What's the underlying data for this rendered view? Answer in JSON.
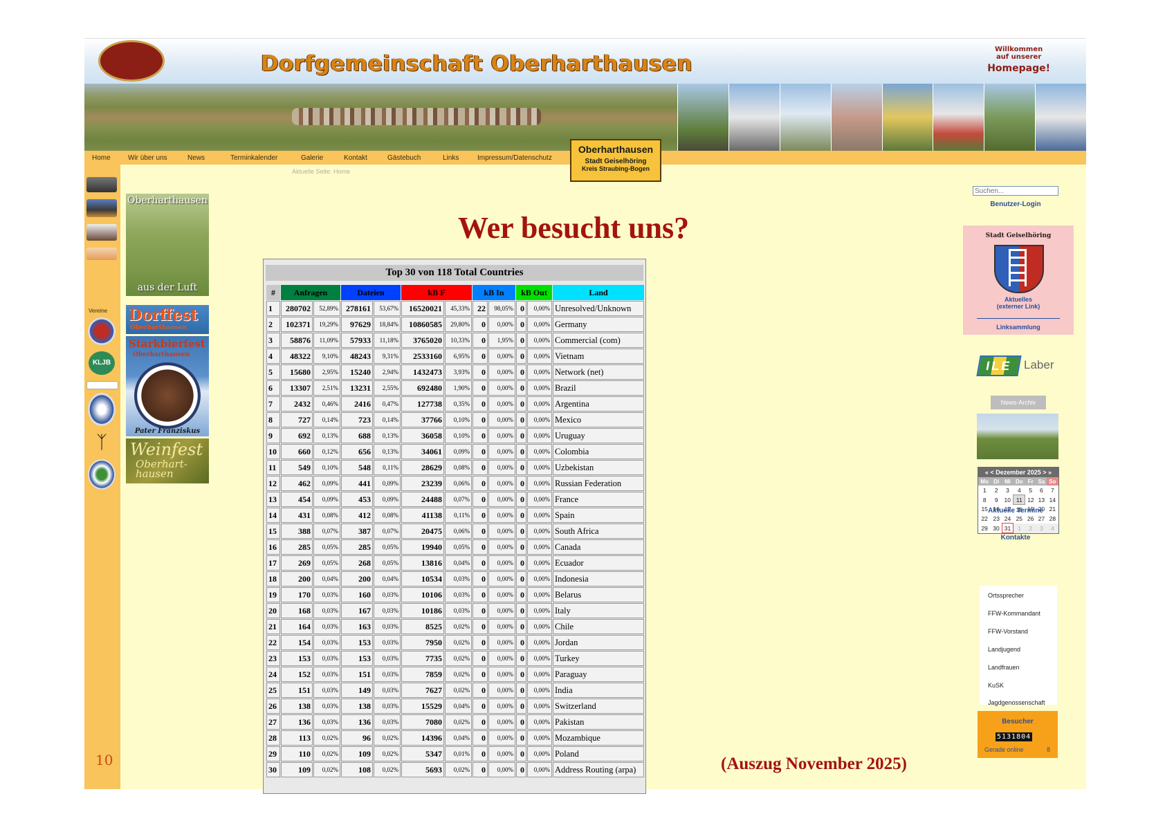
{
  "header": {
    "logo_text": "Dorfgemeinschaft Oberharthausen",
    "site_title": "Dorfgemeinschaft Oberharthausen",
    "welcome_line1": "Willkommen",
    "welcome_line2": "auf unserer",
    "welcome_line3": "Homepage!"
  },
  "nav": {
    "items": [
      "Home",
      "Wir über uns",
      "News",
      "Terminkalender",
      "Galerie",
      "Kontakt",
      "Gästebuch",
      "Links",
      "Impressum/Datenschutz"
    ],
    "current_page": "Aktuelle Seite: Home"
  },
  "ortsschild": {
    "name": "Oberharthausen",
    "line2": "Stadt Geiselhöring",
    "line3": "Kreis Straubing-Bogen"
  },
  "left_sidebar": {
    "vereine_label": "Vereine"
  },
  "promos": {
    "luft_top": "Oberharthausen",
    "luft_bottom": "aus der Luft",
    "dorffest_title": "Dorffest",
    "dorffest_sub": "Oberharthausen",
    "starkbier_title": "Starkbierfest",
    "starkbier_sub": "Oberharthausen",
    "starkbier_caption": "Pater Franziskus",
    "weinfest_title": "Weinfest",
    "weinfest_sub": "Oberhart-hausen"
  },
  "slide": {
    "heading": "Wer besucht uns?",
    "number": "10",
    "footnote": "(Auszug November 2025)"
  },
  "stats": {
    "title": "Top 30 von 118 Total Countries",
    "columns": [
      {
        "label": "#",
        "color": "#c8c8c8"
      },
      {
        "label": "Anfragen",
        "color": "#008040"
      },
      {
        "label": "Dateien",
        "color": "#0040ff"
      },
      {
        "label": "kB F",
        "color": "#ff0000"
      },
      {
        "label": "kB In",
        "color": "#0080ff"
      },
      {
        "label": "kB Out",
        "color": "#00e000"
      },
      {
        "label": "Land",
        "color": "#00e0ff"
      }
    ],
    "rows": [
      [
        "1",
        "280702",
        "52,89%",
        "278161",
        "53,67%",
        "16520021",
        "45,33%",
        "22",
        "98,05%",
        "0",
        "0,00%",
        "Unresolved/Unknown"
      ],
      [
        "2",
        "102371",
        "19,29%",
        "97629",
        "18,84%",
        "10860585",
        "29,80%",
        "0",
        "0,00%",
        "0",
        "0,00%",
        "Germany"
      ],
      [
        "3",
        "58876",
        "11,09%",
        "57933",
        "11,18%",
        "3765020",
        "10,33%",
        "0",
        "1,95%",
        "0",
        "0,00%",
        "Commercial (com)"
      ],
      [
        "4",
        "48322",
        "9,10%",
        "48243",
        "9,31%",
        "2533160",
        "6,95%",
        "0",
        "0,00%",
        "0",
        "0,00%",
        "Vietnam"
      ],
      [
        "5",
        "15680",
        "2,95%",
        "15240",
        "2,94%",
        "1432473",
        "3,93%",
        "0",
        "0,00%",
        "0",
        "0,00%",
        "Network (net)"
      ],
      [
        "6",
        "13307",
        "2,51%",
        "13231",
        "2,55%",
        "692480",
        "1,90%",
        "0",
        "0,00%",
        "0",
        "0,00%",
        "Brazil"
      ],
      [
        "7",
        "2432",
        "0,46%",
        "2416",
        "0,47%",
        "127738",
        "0,35%",
        "0",
        "0,00%",
        "0",
        "0,00%",
        "Argentina"
      ],
      [
        "8",
        "727",
        "0,14%",
        "723",
        "0,14%",
        "37766",
        "0,10%",
        "0",
        "0,00%",
        "0",
        "0,00%",
        "Mexico"
      ],
      [
        "9",
        "692",
        "0,13%",
        "688",
        "0,13%",
        "36058",
        "0,10%",
        "0",
        "0,00%",
        "0",
        "0,00%",
        "Uruguay"
      ],
      [
        "10",
        "660",
        "0,12%",
        "656",
        "0,13%",
        "34061",
        "0,09%",
        "0",
        "0,00%",
        "0",
        "0,00%",
        "Colombia"
      ],
      [
        "11",
        "549",
        "0,10%",
        "548",
        "0,11%",
        "28629",
        "0,08%",
        "0",
        "0,00%",
        "0",
        "0,00%",
        "Uzbekistan"
      ],
      [
        "12",
        "462",
        "0,09%",
        "441",
        "0,09%",
        "23239",
        "0,06%",
        "0",
        "0,00%",
        "0",
        "0,00%",
        "Russian Federation"
      ],
      [
        "13",
        "454",
        "0,09%",
        "453",
        "0,09%",
        "24488",
        "0,07%",
        "0",
        "0,00%",
        "0",
        "0,00%",
        "France"
      ],
      [
        "14",
        "431",
        "0,08%",
        "412",
        "0,08%",
        "41138",
        "0,11%",
        "0",
        "0,00%",
        "0",
        "0,00%",
        "Spain"
      ],
      [
        "15",
        "388",
        "0,07%",
        "387",
        "0,07%",
        "20475",
        "0,06%",
        "0",
        "0,00%",
        "0",
        "0,00%",
        "South Africa"
      ],
      [
        "16",
        "285",
        "0,05%",
        "285",
        "0,05%",
        "19940",
        "0,05%",
        "0",
        "0,00%",
        "0",
        "0,00%",
        "Canada"
      ],
      [
        "17",
        "269",
        "0,05%",
        "268",
        "0,05%",
        "13816",
        "0,04%",
        "0",
        "0,00%",
        "0",
        "0,00%",
        "Ecuador"
      ],
      [
        "18",
        "200",
        "0,04%",
        "200",
        "0,04%",
        "10534",
        "0,03%",
        "0",
        "0,00%",
        "0",
        "0,00%",
        "Indonesia"
      ],
      [
        "19",
        "170",
        "0,03%",
        "160",
        "0,03%",
        "10106",
        "0,03%",
        "0",
        "0,00%",
        "0",
        "0,00%",
        "Belarus"
      ],
      [
        "20",
        "168",
        "0,03%",
        "167",
        "0,03%",
        "10186",
        "0,03%",
        "0",
        "0,00%",
        "0",
        "0,00%",
        "Italy"
      ],
      [
        "21",
        "164",
        "0,03%",
        "163",
        "0,03%",
        "8525",
        "0,02%",
        "0",
        "0,00%",
        "0",
        "0,00%",
        "Chile"
      ],
      [
        "22",
        "154",
        "0,03%",
        "153",
        "0,03%",
        "7950",
        "0,02%",
        "0",
        "0,00%",
        "0",
        "0,00%",
        "Jordan"
      ],
      [
        "23",
        "153",
        "0,03%",
        "153",
        "0,03%",
        "7735",
        "0,02%",
        "0",
        "0,00%",
        "0",
        "0,00%",
        "Turkey"
      ],
      [
        "24",
        "152",
        "0,03%",
        "151",
        "0,03%",
        "7859",
        "0,02%",
        "0",
        "0,00%",
        "0",
        "0,00%",
        "Paraguay"
      ],
      [
        "25",
        "151",
        "0,03%",
        "149",
        "0,03%",
        "7627",
        "0,02%",
        "0",
        "0,00%",
        "0",
        "0,00%",
        "India"
      ],
      [
        "26",
        "138",
        "0,03%",
        "138",
        "0,03%",
        "15529",
        "0,04%",
        "0",
        "0,00%",
        "0",
        "0,00%",
        "Switzerland"
      ],
      [
        "27",
        "136",
        "0,03%",
        "136",
        "0,03%",
        "7080",
        "0,02%",
        "0",
        "0,00%",
        "0",
        "0,00%",
        "Pakistan"
      ],
      [
        "28",
        "113",
        "0,02%",
        "96",
        "0,02%",
        "14396",
        "0,04%",
        "0",
        "0,00%",
        "0",
        "0,00%",
        "Mozambique"
      ],
      [
        "29",
        "110",
        "0,02%",
        "109",
        "0,02%",
        "5347",
        "0,01%",
        "0",
        "0,00%",
        "0",
        "0,00%",
        "Poland"
      ],
      [
        "30",
        "109",
        "0,02%",
        "108",
        "0,02%",
        "5693",
        "0,02%",
        "0",
        "0,00%",
        "0",
        "0,00%",
        "Address Routing (arpa)"
      ]
    ]
  },
  "right_sidebar": {
    "search_placeholder": "Suchen...",
    "login": "Benutzer-Login",
    "stadt_title": "Stadt Geiselhöring",
    "aktuelles_line1": "Aktuelles",
    "aktuelles_line2": "(externer Link)",
    "linksammlung": "Linksammlung",
    "ile_letters": "ILE",
    "ile_word": "Laber",
    "news_archiv": "News-Archiv",
    "aktuelle_termine": "Aktuelle Termine",
    "kontakte_title": "Kontakte",
    "kontakte": [
      "Ortssprecher",
      "FFW-Kommandant",
      "FFW-Vorstand",
      "Landjugend",
      "Landfrauen",
      "KuSK",
      "Jagdgenossenschaft"
    ],
    "besucher_title": "Besucher",
    "besucher_count": "5131804",
    "online_label": "Gerade online",
    "online_count": "8"
  },
  "calendar": {
    "prev_year": "«",
    "prev_month": "<",
    "month_label": "Dezember 2025",
    "next_month": ">",
    "next_year": "»",
    "weekdays": [
      "Mo",
      "Di",
      "Mi",
      "Do",
      "Fr",
      "Sa",
      "So"
    ],
    "weeks": [
      [
        "1",
        "2",
        "3",
        "4",
        "5",
        "6",
        "7"
      ],
      [
        "8",
        "9",
        "10",
        "11",
        "12",
        "13",
        "14"
      ],
      [
        "15",
        "16",
        "17",
        "18",
        "19",
        "20",
        "21"
      ],
      [
        "22",
        "23",
        "24",
        "25",
        "26",
        "27",
        "28"
      ],
      [
        "29",
        "30",
        "31",
        "1",
        "2",
        "3",
        "4"
      ]
    ],
    "today": "11",
    "selected": "31"
  },
  "colors": {
    "frame_bg": "#fffccc",
    "sidebar_orange": "#f8c45b",
    "heading_red": "#a3140c",
    "link_blue": "#2a4f9a"
  }
}
